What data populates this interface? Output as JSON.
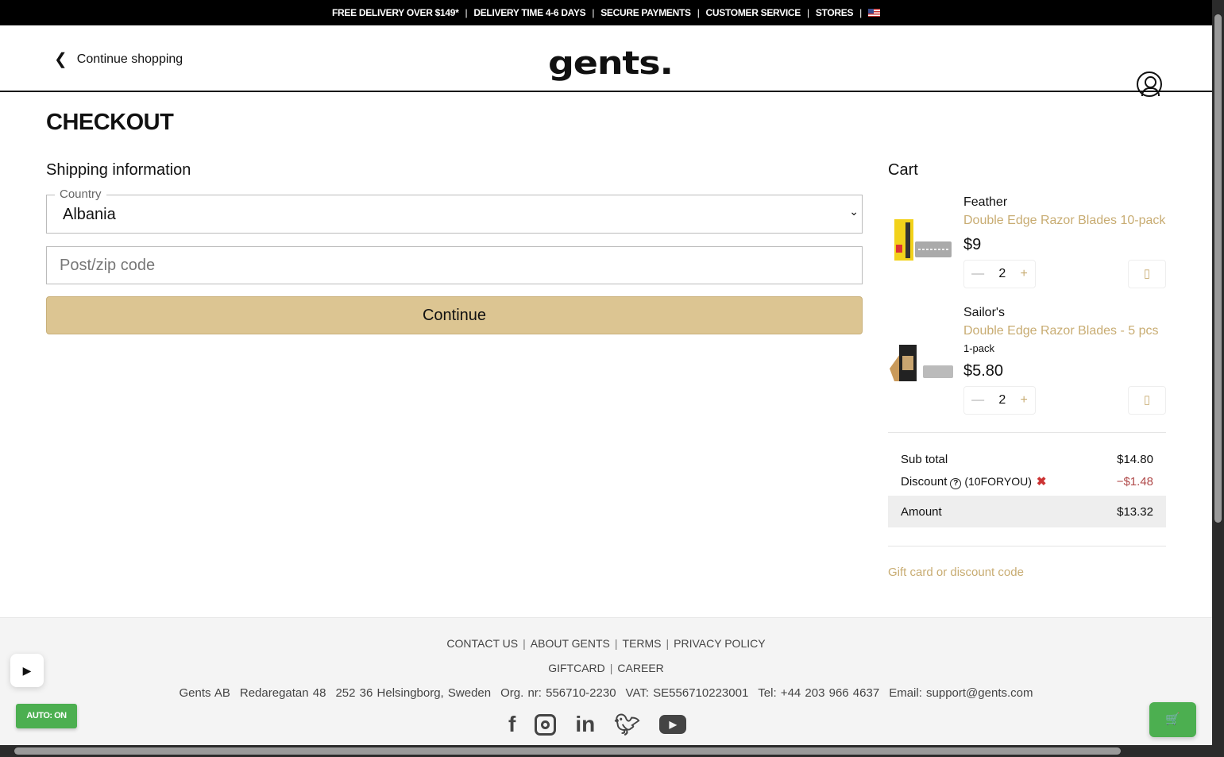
{
  "topbar": {
    "items": [
      "FREE DELIVERY OVER $149*",
      "DELIVERY TIME 4-6 DAYS",
      "SECURE PAYMENTS",
      "CUSTOMER SERVICE",
      "STORES"
    ]
  },
  "header": {
    "back_label": "Continue shopping",
    "logo": "gents."
  },
  "checkout": {
    "title": "CHECKOUT",
    "shipping_title": "Shipping information",
    "country_label": "Country",
    "country_value": "Albania",
    "zip_placeholder": "Post/zip code",
    "continue_label": "Continue"
  },
  "cart": {
    "title": "Cart",
    "items": [
      {
        "brand": "Feather",
        "name": "Double Edge Razor Blades 10-pack",
        "variant": "",
        "price": "$9",
        "qty": "2"
      },
      {
        "brand": "Sailor's",
        "name": "Double Edge Razor Blades - 5 pcs",
        "variant": "1-pack",
        "price": "$5.80",
        "qty": "2"
      }
    ],
    "subtotal_label": "Sub total",
    "subtotal": "$14.80",
    "discount_label": "Discount",
    "discount_code": "(10FORYOU)",
    "discount": "−$1.48",
    "amount_label": "Amount",
    "amount": "$13.32",
    "gift_label": "Gift card or discount code"
  },
  "footer": {
    "links1": [
      "CONTACT US",
      "ABOUT GENTS",
      "TERMS",
      "PRIVACY POLICY"
    ],
    "links2": [
      "GIFTCARD",
      "CAREER"
    ],
    "address": [
      "Gents AB",
      "Redaregatan 48",
      "252 36 Helsingborg, Sweden",
      "Org. nr: 556710-2230",
      "VAT: SE556710223001",
      "Tel: +44 203 966 4637",
      "Email: support@gents.com"
    ]
  },
  "widgets": {
    "auto_label": "AUTO: ON"
  },
  "colors": {
    "accent": "#dcc592",
    "link": "#c8ac72",
    "green": "#4caf50"
  }
}
